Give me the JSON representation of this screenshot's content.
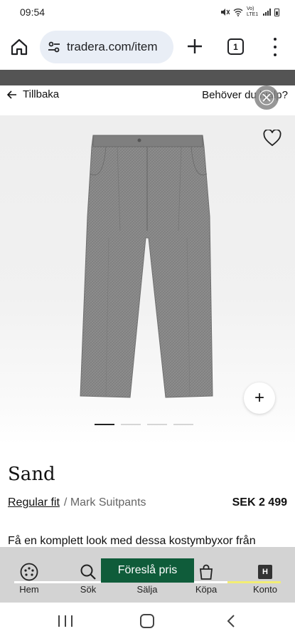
{
  "status_bar": {
    "time": "09:54",
    "network": "Vo) LTE1"
  },
  "browser": {
    "url": "tradera.com/item",
    "tab_count": "1"
  },
  "header": {
    "back_label": "Tillbaka",
    "help_label": "Behöver du hjälp?"
  },
  "product": {
    "image_count": 4,
    "active_image": 0,
    "title": "Sand",
    "fit": "Regular fit",
    "model": "/ Mark Suitpants",
    "price": "SEK 2 499",
    "description": "Få en komplett look med dessa kostymbyxor från"
  },
  "bottom_nav": {
    "items": [
      {
        "label": "Hem",
        "icon": "home-logo-icon"
      },
      {
        "label": "Sök",
        "icon": "search-icon"
      },
      {
        "label": "Sälja",
        "icon": "sell-icon"
      },
      {
        "label": "Köpa",
        "icon": "shopping-bag-icon"
      },
      {
        "label": "Konto",
        "icon": "account-icon"
      }
    ],
    "account_badge": "H",
    "suggest_price_label": "Föreslå pris",
    "accent_colors": {
      "button": "#0f5c3a",
      "line_green": "#0f5c3a",
      "line_yellow": "#f3ee73"
    }
  }
}
